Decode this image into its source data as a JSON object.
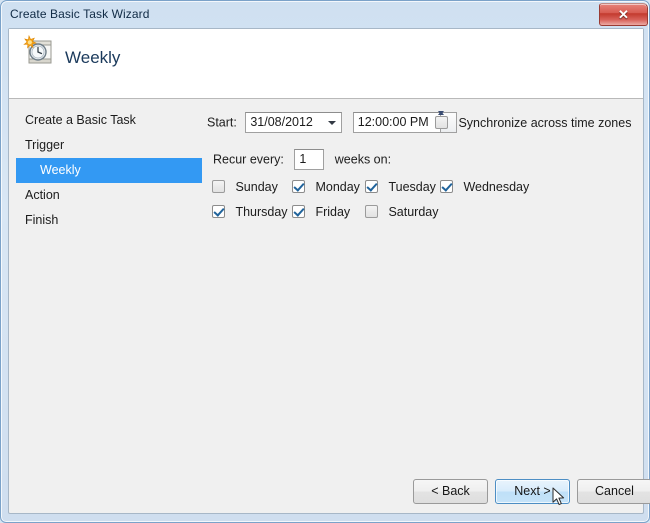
{
  "window": {
    "title": "Create Basic Task Wizard",
    "close_label": "✕",
    "close_icon": "close-icon"
  },
  "header": {
    "icon": "calendar-clock-icon",
    "title": "Weekly"
  },
  "sidebar": {
    "items": [
      {
        "label": "Create a Basic Task",
        "selected": false,
        "child": false
      },
      {
        "label": "Trigger",
        "selected": false,
        "child": false
      },
      {
        "label": "Weekly",
        "selected": true,
        "child": true
      },
      {
        "label": "Action",
        "selected": false,
        "child": false
      },
      {
        "label": "Finish",
        "selected": false,
        "child": false
      }
    ]
  },
  "main": {
    "start_label": "Start:",
    "start_date": "31/08/2012",
    "start_time": "12:00:00 PM",
    "sync_label": "Synchronize across time zones",
    "sync_checked": false,
    "recur_label": "Recur every:",
    "recur_value": "1",
    "recur_suffix": "weeks on:",
    "days": [
      {
        "label": "Sunday",
        "checked": false
      },
      {
        "label": "Monday",
        "checked": true
      },
      {
        "label": "Tuesday",
        "checked": true
      },
      {
        "label": "Wednesday",
        "checked": true
      },
      {
        "label": "Thursday",
        "checked": true
      },
      {
        "label": "Friday",
        "checked": true
      },
      {
        "label": "Saturday",
        "checked": false
      }
    ]
  },
  "footer": {
    "back_label": "< Back",
    "next_label": "Next >",
    "cancel_label": "Cancel"
  },
  "colors": {
    "selection_blue": "#3399f3",
    "close_red": "#c33a2e",
    "default_button_blue": "#bfe0f8",
    "title_text": "#102a45"
  }
}
